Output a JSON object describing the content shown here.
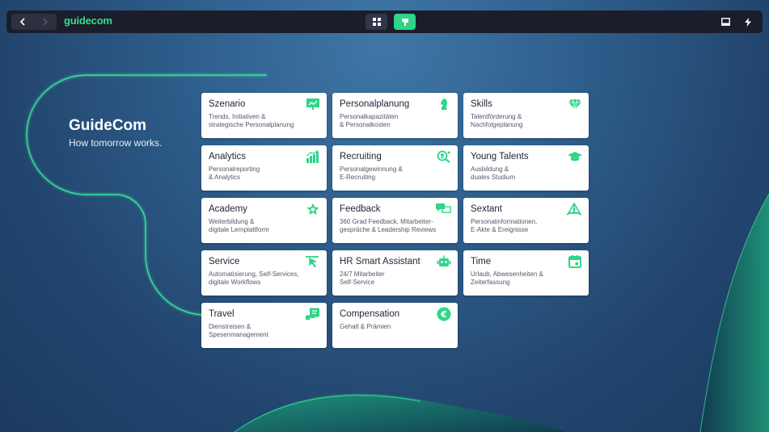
{
  "topbar": {
    "back_icon": "chevron-left-icon",
    "forward_icon": "chevron-right-icon",
    "brand": "guidecom",
    "view_grid_icon": "grid-icon",
    "view_tiles_icon": "flag-icon",
    "window_icon": "window-icon",
    "bolt_icon": "bolt-icon"
  },
  "hero": {
    "title": "GuideCom",
    "subtitle": "How tomorrow works."
  },
  "colors": {
    "accent": "#2ed58a",
    "topbar": "#1c1d2b",
    "tile_title": "#24263a"
  },
  "tiles": [
    {
      "title": "Szenario",
      "desc": [
        "Trends, Initiativen &",
        "strategische Personalplanung"
      ],
      "icon": "presentation-icon"
    },
    {
      "title": "Personalplanung",
      "desc": [
        "Personalkapazitäten",
        "& Personalkosten"
      ],
      "icon": "chess-knight-icon"
    },
    {
      "title": "Skills",
      "desc": [
        "Talentförderung &",
        "Nachfolgeplanung"
      ],
      "icon": "diamond-icon"
    },
    {
      "title": "Analytics",
      "desc": [
        "Personalreporting",
        "& Analytics"
      ],
      "icon": "bar-chart-icon"
    },
    {
      "title": "Recruiting",
      "desc": [
        "Personalgewinnung &",
        "E-Recruiting"
      ],
      "icon": "user-search-icon"
    },
    {
      "title": "Young Talents",
      "desc": [
        "Ausbildung &",
        "duales Studium"
      ],
      "icon": "graduation-cap-icon"
    },
    {
      "title": "Academy",
      "desc": [
        "Weiterbildung &",
        "digitale Lernplattform"
      ],
      "icon": "star-badge-icon"
    },
    {
      "title": "Feedback",
      "desc": [
        "360 Grad Feedback, Mitarbeiter-",
        "gespräche & Leadership Reviews"
      ],
      "icon": "chat-bubbles-icon"
    },
    {
      "title": "Sextant",
      "desc": [
        "Personalinformationen,",
        "E-Akte & Ereignisse"
      ],
      "icon": "sextant-icon"
    },
    {
      "title": "Service",
      "desc": [
        "Automatisierung, Self-Services,",
        "digitale Workflows"
      ],
      "icon": "cursor-click-icon"
    },
    {
      "title": "HR Smart Assistant",
      "desc": [
        "24/7 Mitarbeiter",
        "Self-Service"
      ],
      "icon": "robot-icon"
    },
    {
      "title": "Time",
      "desc": [
        "Urlaub, Abwesenheiten &",
        "Zeiterfassung"
      ],
      "icon": "calendar-icon"
    },
    {
      "title": "Travel",
      "desc": [
        "Dienstreisen &",
        "Spesenmanagement"
      ],
      "icon": "receipt-icon"
    },
    {
      "title": "Compensation",
      "desc": [
        "Gehalt & Prämien"
      ],
      "icon": "euro-coin-icon"
    }
  ]
}
